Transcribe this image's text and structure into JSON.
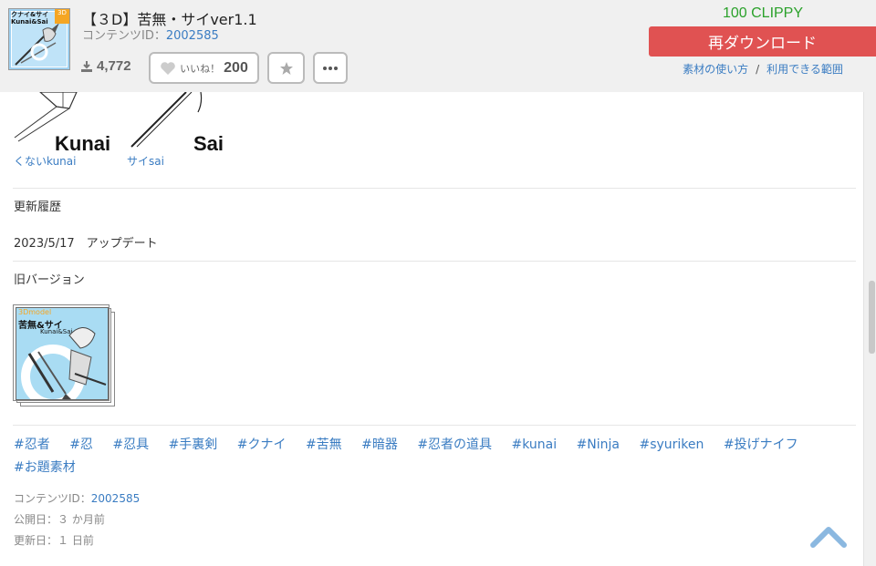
{
  "header": {
    "thumbnail_text": "クナイ&サイ Kunai&Sai",
    "thumbnail_badge": "3D",
    "title": "【３D】苦無・サイver1.1",
    "content_id_label": "コンテンツID：",
    "content_id": "2002585",
    "download_count": "4,772",
    "like_label": "いいね！",
    "like_count": "200",
    "clippy": "100 CLIPPY",
    "redownload_label": "再ダウンロード",
    "usage_link": "素材の使い方",
    "link_separator": "/",
    "scope_link": "利用できる範囲"
  },
  "preview": {
    "kunai_label": "Kunai",
    "sai_label": "Sai",
    "kunai_caption": "くないkunai",
    "sai_caption": "サイsai"
  },
  "history": {
    "heading": "更新履歴",
    "entry": "2023/5/17　アップデート"
  },
  "old_versions": {
    "heading": "旧バージョン",
    "thumb_text_1": "3Dmodel",
    "thumb_text_2": "苦無&サイ",
    "thumb_text_3": "Kunai&Sai"
  },
  "tags": [
    "#忍者",
    "#忍",
    "#忍具",
    "#手裏剣",
    "#クナイ",
    "#苦無",
    "#暗器",
    "#忍者の道具",
    "#kunai",
    "#Ninja",
    "#syuriken",
    "#投げナイフ",
    "#お題素材"
  ],
  "meta": {
    "content_id_label": "コンテンツID：",
    "content_id": "2002585",
    "published": "公開日：３ か月前",
    "updated": "更新日：１ 日前"
  },
  "colors": {
    "accent_link": "#3a7cc2",
    "clippy_green": "#2aa12a",
    "redownload_red": "#e05252"
  }
}
